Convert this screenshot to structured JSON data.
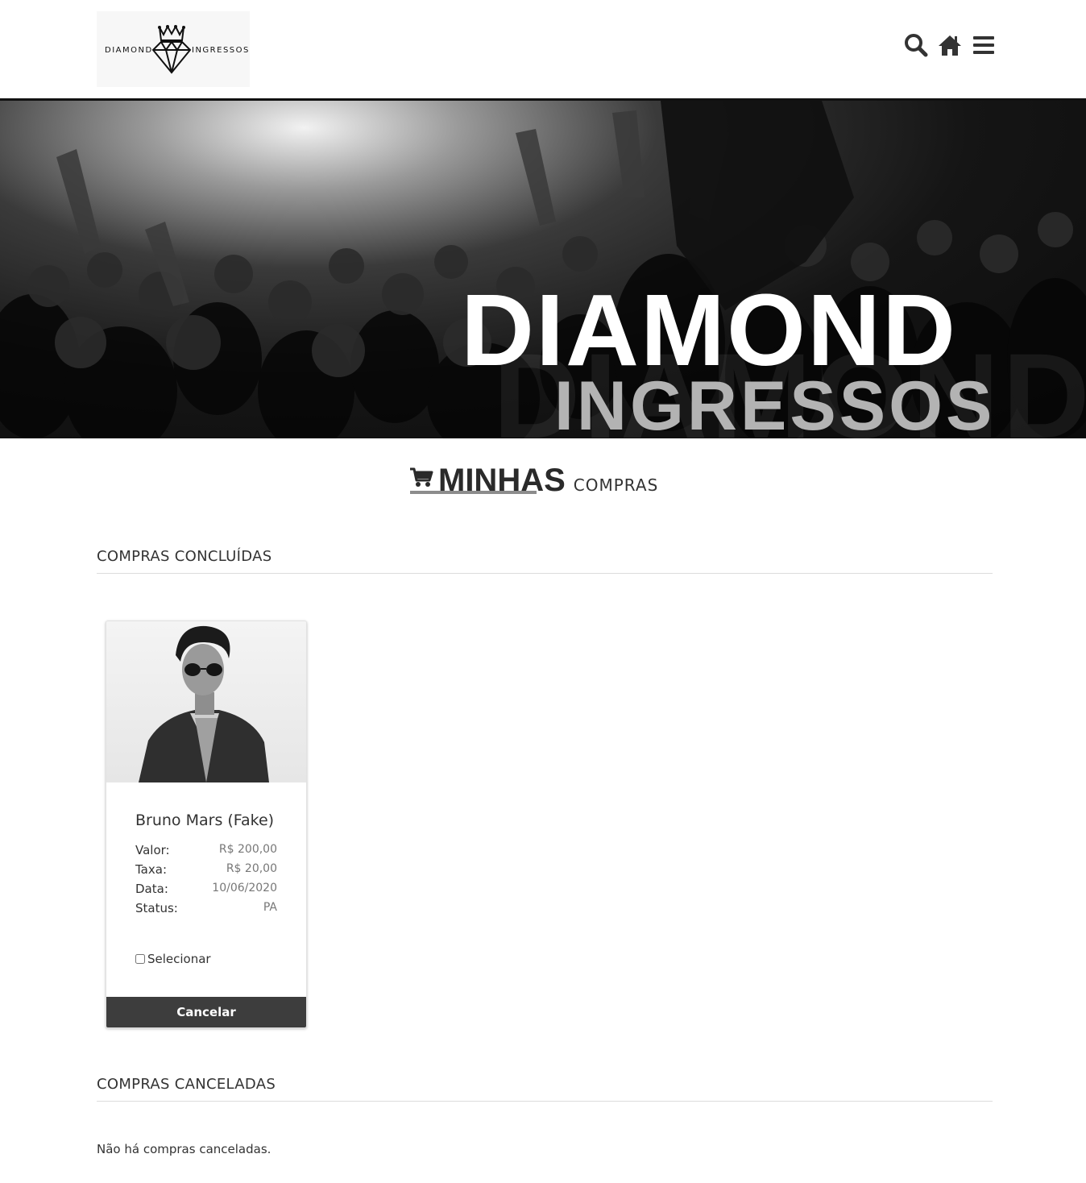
{
  "header": {
    "logo": {
      "left_word": "DIAMOND",
      "right_word": "INGRESSOS"
    },
    "icons": [
      "search-icon",
      "home-icon",
      "menu-icon"
    ]
  },
  "banner": {
    "line1": "DIAMOND",
    "line2": "INGRESSOS"
  },
  "page": {
    "title_bold": "MINHAS",
    "title_light": "COMPRAS"
  },
  "completed": {
    "title": "COMPRAS CONCLUÍDAS",
    "purchases": [
      {
        "event": "Bruno Mars (Fake)",
        "fields": [
          {
            "label": "Valor:",
            "value": "R$ 200,00"
          },
          {
            "label": "Taxa:",
            "value": "R$ 20,00"
          },
          {
            "label": "Data:",
            "value": "10/06/2020"
          },
          {
            "label": "Status:",
            "value": "PA"
          }
        ],
        "select_label": "Selecionar",
        "cancel_label": "Cancelar"
      }
    ]
  },
  "cancelled": {
    "title": "COMPRAS CANCELADAS",
    "empty_message": "Não há compras canceladas."
  },
  "colors": {
    "dark_button": "#3d3d3d",
    "heading_underline": "#8c8c8c",
    "banner_accent": "#b3b3b3"
  }
}
